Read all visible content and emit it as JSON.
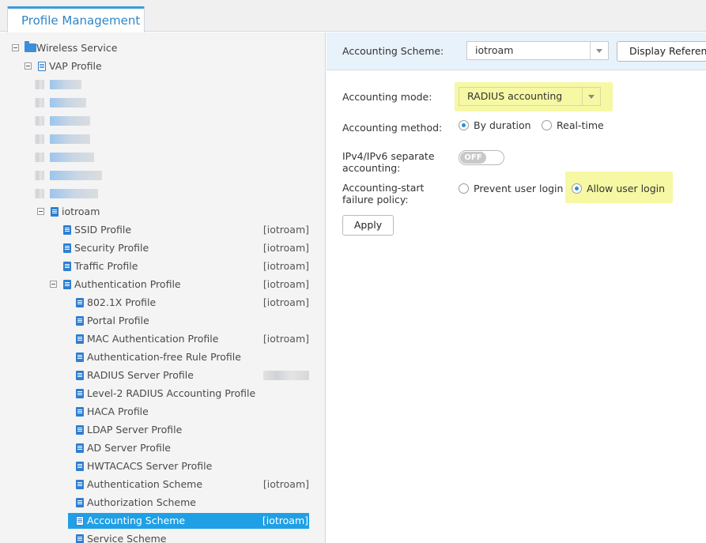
{
  "tab": {
    "label": "Profile Management"
  },
  "tree": {
    "wireless_service": "Wireless Service",
    "vap_profile": "VAP Profile",
    "iotroam": "iotroam",
    "items": [
      {
        "label": "SSID Profile",
        "tag": "[iotroam]"
      },
      {
        "label": "Security Profile",
        "tag": "[iotroam]"
      },
      {
        "label": "Traffic Profile",
        "tag": "[iotroam]"
      },
      {
        "label": "Authentication Profile",
        "tag": "[iotroam]"
      }
    ],
    "auth_children": [
      {
        "label": "802.1X Profile",
        "tag": "[iotroam]"
      },
      {
        "label": "Portal Profile",
        "tag": ""
      },
      {
        "label": "MAC Authentication Profile",
        "tag": "[iotroam]"
      },
      {
        "label": "Authentication-free Rule Profile",
        "tag": ""
      },
      {
        "label": "RADIUS Server Profile",
        "tag": ""
      },
      {
        "label": "Level-2 RADIUS Accounting Profile",
        "tag": ""
      },
      {
        "label": "HACA Profile",
        "tag": ""
      },
      {
        "label": "LDAP Server Profile",
        "tag": ""
      },
      {
        "label": "AD Server Profile",
        "tag": ""
      },
      {
        "label": "HWTACACS Server Profile",
        "tag": ""
      },
      {
        "label": "Authentication Scheme",
        "tag": "[iotroam]"
      },
      {
        "label": "Authorization Scheme",
        "tag": ""
      },
      {
        "label": "Accounting Scheme",
        "tag": "[iotroam]"
      },
      {
        "label": "Service Scheme",
        "tag": ""
      }
    ]
  },
  "header": {
    "scheme_label": "Accounting Scheme:",
    "scheme_value": "iotroam",
    "display_button": "Display Reference"
  },
  "form": {
    "mode_label": "Accounting mode:",
    "mode_value": "RADIUS accounting",
    "method_label": "Accounting method:",
    "method_options": [
      "By duration",
      "Real-time"
    ],
    "separate_label": "IPv4/IPv6 separate accounting:",
    "separate_state": "OFF",
    "failure_label": "Accounting-start failure policy:",
    "failure_options": [
      "Prevent user login",
      "Allow user login"
    ],
    "apply_button": "Apply"
  },
  "colors": {
    "accent": "#1fa0e6",
    "highlight": "#f6f8a4"
  }
}
